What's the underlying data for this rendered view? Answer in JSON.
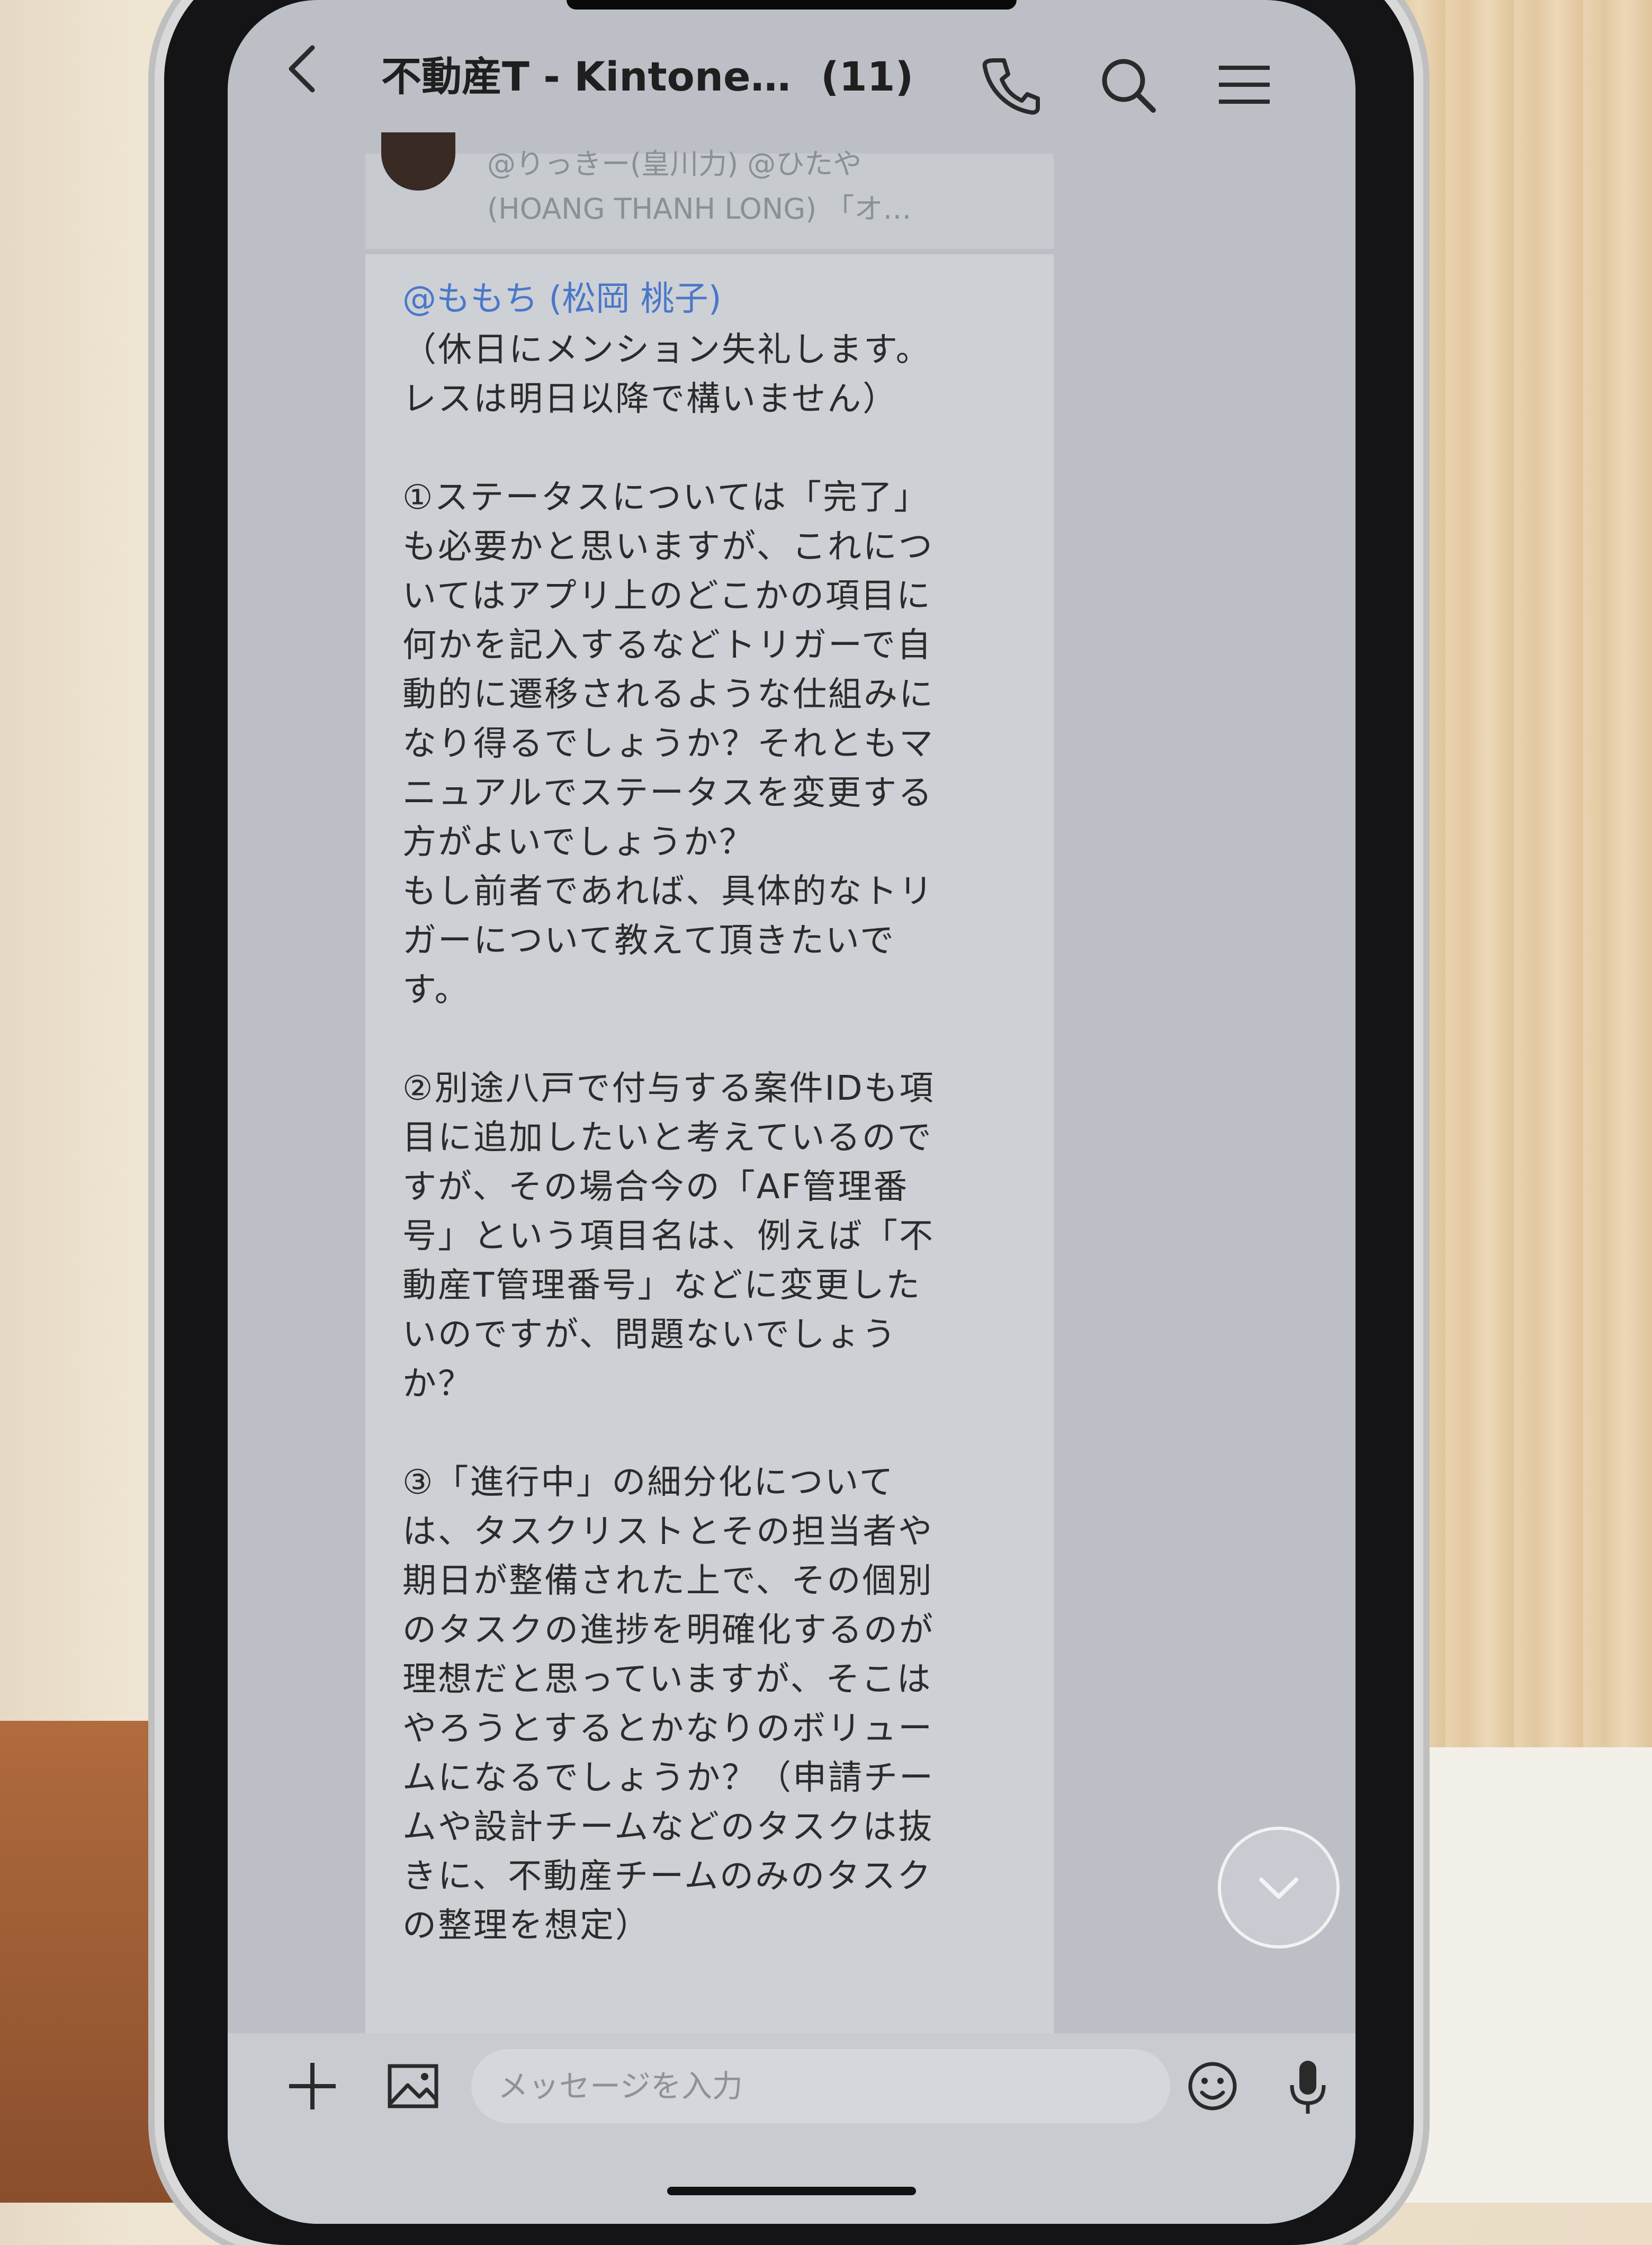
{
  "header": {
    "title": "不動産T - Kintone…",
    "member_count": "(11)"
  },
  "quoted": {
    "line1": "@りっきー(皇川力) @ひたや",
    "line2": "(HOANG THANH LONG) 「オ…"
  },
  "message": {
    "mention": "@ももち (松岡 桃子)",
    "body": "（休日にメンション失礼します。\nレスは明日以降で構いません）\n\n①ステータスについては「完了」\nも必要かと思いますが、これにつ\nいてはアプリ上のどこかの項目に\n何かを記入するなどトリガーで自\n動的に遷移されるような仕組みに\nなり得るでしょうか？それともマ\nニュアルでステータスを変更する\n方がよいでしょうか？\nもし前者であれば、具体的なトリ\nガーについて教えて頂きたいで\nす。\n\n②別途八戸で付与する案件IDも項\n目に追加したいと考えているので\nすが、その場合今の「AF管理番\n号」という項目名は、例えば「不\n動産T管理番号」などに変更した\nいのですが、問題ないでしょう\nか？\n\n③「進行中」の細分化について\nは、タスクリストとその担当者や\n期日が整備された上で、その個別\nのタスクの進捗を明確化するのが\n理想だと思っていますが、そこは\nやろうとするとかなりのボリュー\nムになるでしょうか？（申請チー\nムや設計チームなどのタスクは抜\nきに、不動産チームのみのタスク\nの整理を想定）"
  },
  "input": {
    "placeholder": "メッセージを入力"
  },
  "icons": {
    "back": "chevron-left-icon",
    "call": "phone-icon",
    "search": "search-icon",
    "menu": "menu-icon",
    "add": "plus-icon",
    "image": "image-icon",
    "emoji": "emoji-icon",
    "mic": "mic-icon",
    "scroll": "chevron-down-icon"
  },
  "colors": {
    "mention": "#4a77c9",
    "bubble": "#cdd0d5",
    "screen": "#bcc0c6"
  }
}
